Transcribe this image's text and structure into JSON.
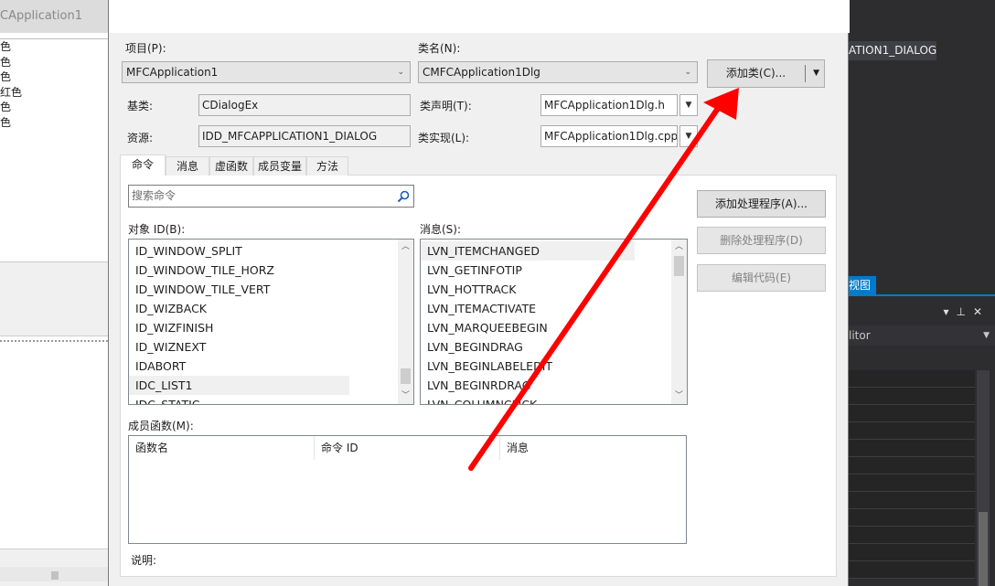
{
  "left_window": {
    "title": "CApplication1",
    "items": [
      "色",
      "色",
      "色",
      "红色",
      "色",
      "色"
    ]
  },
  "right_ide": {
    "dialog_chip": "ATION1_DIALOG",
    "view_tab": "视图",
    "editor_label": "litor"
  },
  "dialog": {
    "project_label": "项目(P):",
    "project_value": "MFCApplication1",
    "class_name_label": "类名(N):",
    "class_name_value": "CMFCApplication1Dlg",
    "add_class_button": "添加类(C)...",
    "base_class_label": "基类:",
    "base_class_value": "CDialogEx",
    "class_decl_label": "类声明(T):",
    "class_decl_value": "MFCApplication1Dlg.h",
    "resource_label": "资源:",
    "resource_value": "IDD_MFCAPPLICATION1_DIALOG",
    "class_impl_label": "类实现(L):",
    "class_impl_value": "MFCApplication1Dlg.cpp",
    "tabs": [
      {
        "label": "命令"
      },
      {
        "label": "消息"
      },
      {
        "label": "虚函数"
      },
      {
        "label": "成员变量"
      },
      {
        "label": "方法"
      }
    ],
    "search_placeholder": "搜索命令",
    "object_ids_label": "对象 ID(B):",
    "object_ids": [
      "ID_WINDOW_SPLIT",
      "ID_WINDOW_TILE_HORZ",
      "ID_WINDOW_TILE_VERT",
      "ID_WIZBACK",
      "ID_WIZFINISH",
      "ID_WIZNEXT",
      "IDABORT",
      "IDC_LIST1",
      "IDC_STATIC"
    ],
    "selected_object_id": "IDC_LIST1",
    "messages_label": "消息(S):",
    "messages": [
      "LVN_ITEMCHANGED",
      "LVN_GETINFOTIP",
      "LVN_HOTTRACK",
      "LVN_ITEMACTIVATE",
      "LVN_MARQUEEBEGIN",
      "LVN_BEGINDRAG",
      "LVN_BEGINLABELEDIT",
      "LVN_BEGINRDRAG",
      "LVN_COLUMNCLICK"
    ],
    "selected_message": "LVN_ITEMCHANGED",
    "add_handler_button": "添加处理程序(A)...",
    "delete_handler_button": "删除处理程序(D)",
    "edit_code_button": "编辑代码(E)",
    "member_functions_label": "成员函数(M):",
    "member_columns": [
      "函数名",
      "命令 ID",
      "消息"
    ],
    "description_label": "说明:"
  },
  "colors": {
    "arrow": "#ff0000",
    "dialog_bg": "#f0f0f0",
    "ide_dark": "#2d2d30",
    "ide_accent": "#007acc"
  }
}
